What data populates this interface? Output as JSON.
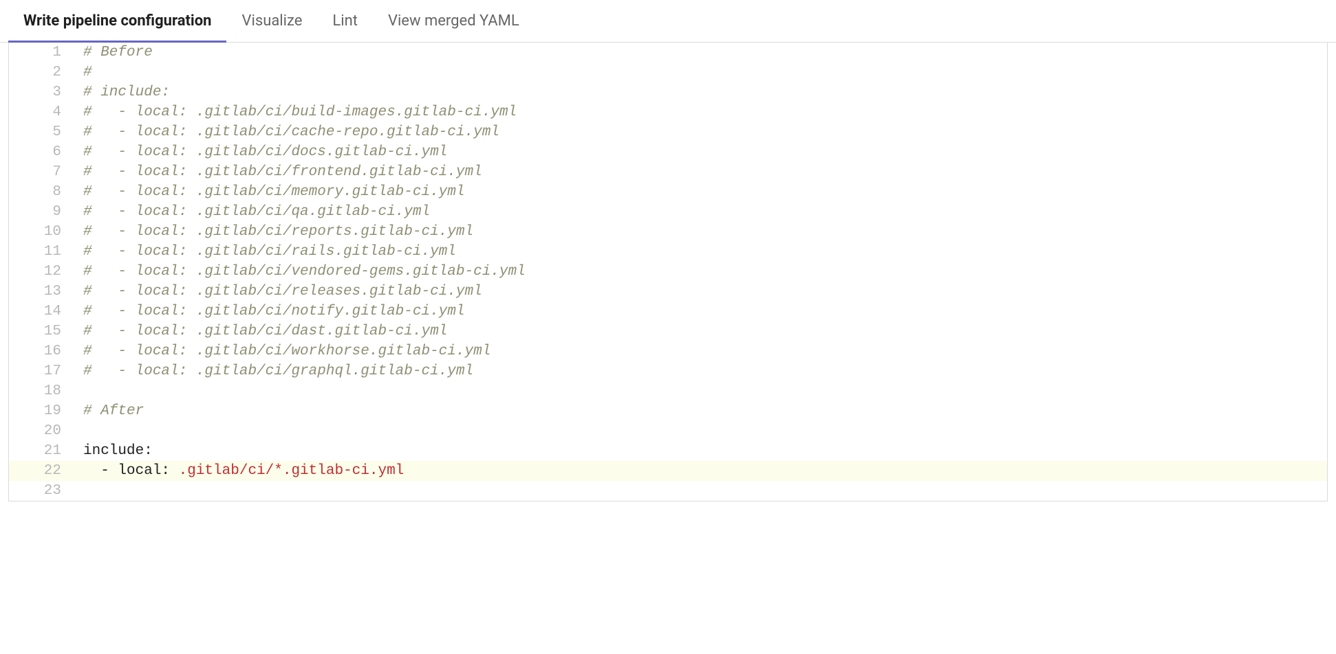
{
  "tabs": [
    {
      "label": "Write pipeline configuration",
      "active": true
    },
    {
      "label": "Visualize",
      "active": false
    },
    {
      "label": "Lint",
      "active": false
    },
    {
      "label": "View merged YAML",
      "active": false
    }
  ],
  "code_lines": [
    {
      "num": 1,
      "type": "comment",
      "text": "# Before"
    },
    {
      "num": 2,
      "type": "comment",
      "text": "#"
    },
    {
      "num": 3,
      "type": "comment",
      "text": "# include:"
    },
    {
      "num": 4,
      "type": "comment",
      "text": "#   - local: .gitlab/ci/build-images.gitlab-ci.yml"
    },
    {
      "num": 5,
      "type": "comment",
      "text": "#   - local: .gitlab/ci/cache-repo.gitlab-ci.yml"
    },
    {
      "num": 6,
      "type": "comment",
      "text": "#   - local: .gitlab/ci/docs.gitlab-ci.yml"
    },
    {
      "num": 7,
      "type": "comment",
      "text": "#   - local: .gitlab/ci/frontend.gitlab-ci.yml"
    },
    {
      "num": 8,
      "type": "comment",
      "text": "#   - local: .gitlab/ci/memory.gitlab-ci.yml"
    },
    {
      "num": 9,
      "type": "comment",
      "text": "#   - local: .gitlab/ci/qa.gitlab-ci.yml"
    },
    {
      "num": 10,
      "type": "comment",
      "text": "#   - local: .gitlab/ci/reports.gitlab-ci.yml"
    },
    {
      "num": 11,
      "type": "comment",
      "text": "#   - local: .gitlab/ci/rails.gitlab-ci.yml"
    },
    {
      "num": 12,
      "type": "comment",
      "text": "#   - local: .gitlab/ci/vendored-gems.gitlab-ci.yml"
    },
    {
      "num": 13,
      "type": "comment",
      "text": "#   - local: .gitlab/ci/releases.gitlab-ci.yml"
    },
    {
      "num": 14,
      "type": "comment",
      "text": "#   - local: .gitlab/ci/notify.gitlab-ci.yml"
    },
    {
      "num": 15,
      "type": "comment",
      "text": "#   - local: .gitlab/ci/dast.gitlab-ci.yml"
    },
    {
      "num": 16,
      "type": "comment",
      "text": "#   - local: .gitlab/ci/workhorse.gitlab-ci.yml"
    },
    {
      "num": 17,
      "type": "comment",
      "text": "#   - local: .gitlab/ci/graphql.gitlab-ci.yml"
    },
    {
      "num": 18,
      "type": "blank",
      "text": ""
    },
    {
      "num": 19,
      "type": "comment",
      "text": "# After"
    },
    {
      "num": 20,
      "type": "blank",
      "text": ""
    },
    {
      "num": 21,
      "type": "key",
      "text": "include:"
    },
    {
      "num": 22,
      "type": "keyval",
      "key_text": "  - local: ",
      "val_text": ".gitlab/ci/*.gitlab-ci.yml",
      "highlighted": true
    },
    {
      "num": 23,
      "type": "blank",
      "text": ""
    }
  ]
}
